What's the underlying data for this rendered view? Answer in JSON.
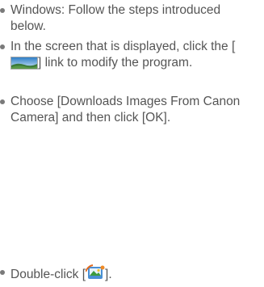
{
  "instructions": [
    {
      "text": "Windows: Follow the steps introduced below."
    },
    {
      "text_before": "In the screen that is displayed, click the [",
      "icon": "link-image-icon",
      "text_after": "] link to modify the program."
    },
    {
      "text": "Choose [Downloads Images From Canon Camera] and then click [OK]."
    },
    {
      "text_before": "Double-click [",
      "icon": "camerawindow-app-icon",
      "text_after": "]."
    }
  ]
}
